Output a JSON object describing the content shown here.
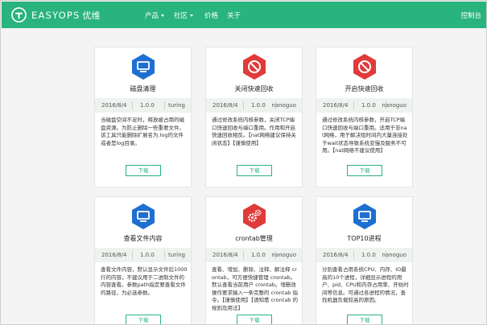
{
  "nav": {
    "brand": "EASYOPS",
    "brand_cn": "优维",
    "items": [
      {
        "label": "产品",
        "dropdown": true
      },
      {
        "label": "社区",
        "dropdown": true
      },
      {
        "label": "价格",
        "dropdown": false
      },
      {
        "label": "关于",
        "dropdown": false
      }
    ],
    "console": "控制台"
  },
  "colors": {
    "brand_green": "#29b37d",
    "icon_blue": "#1f6fd1",
    "icon_red": "#e03a3a"
  },
  "cards": [
    {
      "title": "磁盘清理",
      "icon": "monitor-icon",
      "icon_color": "#1f6fd1",
      "date": "2016/8/4",
      "version": "1.0.0",
      "author": "turing",
      "desc": "当磁盘空间不足时，释放被占用的磁盘资源。为防止删除一些重要文件，该工具只能删除扩展名为.log的文件或者是log目录。",
      "button": "下载"
    },
    {
      "title": "关闭快速回收",
      "icon": "prohibited-icon",
      "icon_color": "#e03a3a",
      "date": "2016/8/4",
      "version": "1.0.0",
      "author": "nanoguo",
      "desc": "通过修改系统内核参数，关闭TCP端口快速回收与端口重用。作用和开启快速回收相反。【nat网络建议保持关闭状态】【谨慎使用】",
      "button": "下载"
    },
    {
      "title": "开启快速回收",
      "icon": "prohibited-icon",
      "icon_color": "#e03a3a",
      "date": "2016/8/4",
      "version": "1.0.0",
      "author": "nanoguo",
      "desc": "通过修改系统内核参数，开启TCP端口快速回收与端口重用。适用于非nat网络，用于解决短时间内大量连接处于wait状态导致系统变慢及服务不可用。【nat网络不建议使用】",
      "button": "下载"
    },
    {
      "title": "查看文件内容",
      "icon": "monitor-icon",
      "icon_color": "#1f6fd1",
      "date": "2016/8/4",
      "version": "1.0.0",
      "author": "turing",
      "desc": "查看文件内容，默认显示文件后1000行的内容，不建议用于二进制文件的内容查看。参数path指定要查看文件的路径，为必选参数。",
      "button": "下载"
    },
    {
      "title": "crontab管理",
      "icon": "gears-icon",
      "icon_color": "#e03a3a",
      "date": "2016/8/4",
      "version": "1.0.0",
      "author": "nanoguo",
      "desc": "查看、增加、删除、注释、解注释 crontab，可方便快捷管理 crontab。默认查看当前用户 crontab。增删改操作要求输入一条完整的 crontab 指令。【谨慎使用】【请知悉 crontab 的规则及用法】",
      "button": "下载"
    },
    {
      "title": "TOP10进程",
      "icon": "monitor-icon",
      "icon_color": "#1f6fd1",
      "date": "2016/8/4",
      "version": "1.0.0",
      "author": "nanoguo",
      "desc": "分别查看占用系统CPU、内存、IO最高的10个进程，详细显示进程的用户、pid、CPU和内存占用率、开始时间等信息。可通过各进程的情况，查找机器负载较高的原因。",
      "button": "下载"
    }
  ]
}
